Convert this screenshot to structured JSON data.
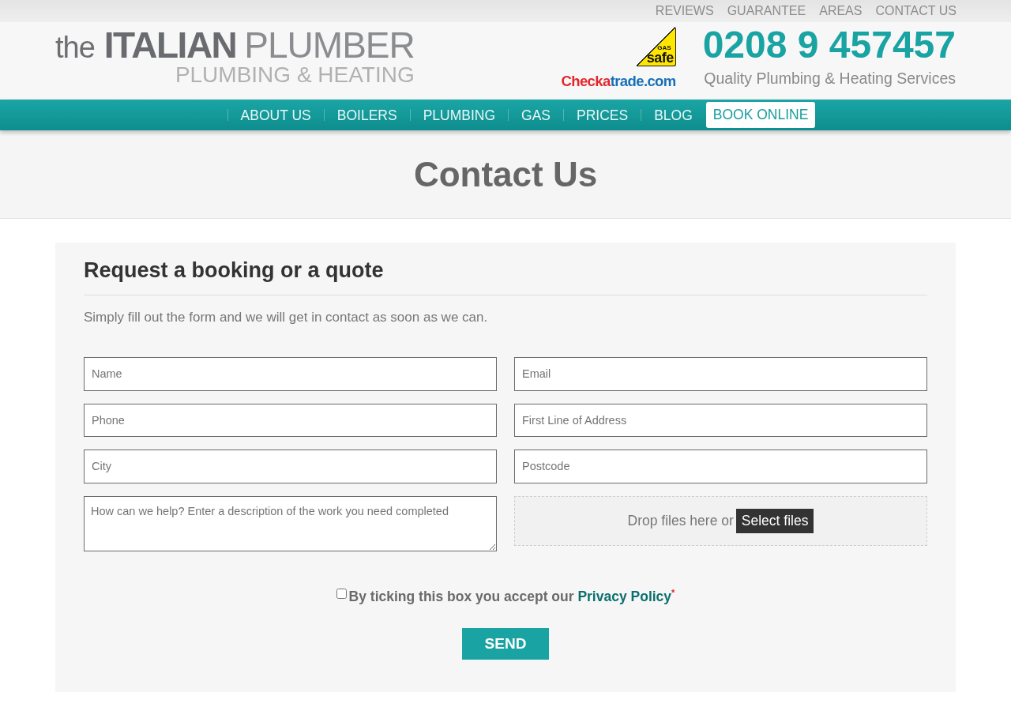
{
  "top_links": [
    "REVIEWS",
    "GUARANTEE",
    "AREAS",
    "CONTACT US"
  ],
  "header": {
    "logo": {
      "article": "the",
      "name_bold": "ITALIAN",
      "name_light": "PLUMBER",
      "tagline": "PLUMBING & HEATING"
    },
    "gas_safe_logo": {
      "small_text": "GAS",
      "text": "safe"
    },
    "checkatrade_logo": [
      "Checka",
      "trade.com"
    ],
    "phone": "0208 9 457457",
    "tagline": "Quality Plumbing & Heating Services"
  },
  "nav": [
    {
      "label": "ABOUT US",
      "kind": "link"
    },
    {
      "label": "BOILERS",
      "kind": "link"
    },
    {
      "label": "PLUMBING",
      "kind": "link"
    },
    {
      "label": "GAS",
      "kind": "link"
    },
    {
      "label": "PRICES",
      "kind": "link"
    },
    {
      "label": "BLOG",
      "kind": "link"
    },
    {
      "label": "BOOK ONLINE",
      "kind": "button"
    }
  ],
  "page_title": "Contact Us",
  "form": {
    "title": "Request a booking or a quote",
    "intro": "Simply fill out the form and we will get in contact as soon as we can.",
    "fields": [
      {
        "kind": "input",
        "placeholder": "Name"
      },
      {
        "kind": "input",
        "placeholder": "Email"
      },
      {
        "kind": "input",
        "placeholder": "Phone"
      },
      {
        "kind": "input",
        "placeholder": "First Line of Address"
      },
      {
        "kind": "input",
        "placeholder": "City"
      },
      {
        "kind": "input",
        "placeholder": "Postcode"
      },
      {
        "kind": "textarea",
        "placeholder": "How can we help? Enter a description of the work you need completed"
      },
      {
        "kind": "dropzone",
        "text": "Drop files here or",
        "button": "Select files"
      }
    ],
    "consent": {
      "checked": false,
      "text": "By ticking this box you accept our",
      "link": "Privacy Policy",
      "required_mark": "*"
    },
    "submit": "SEND"
  }
}
